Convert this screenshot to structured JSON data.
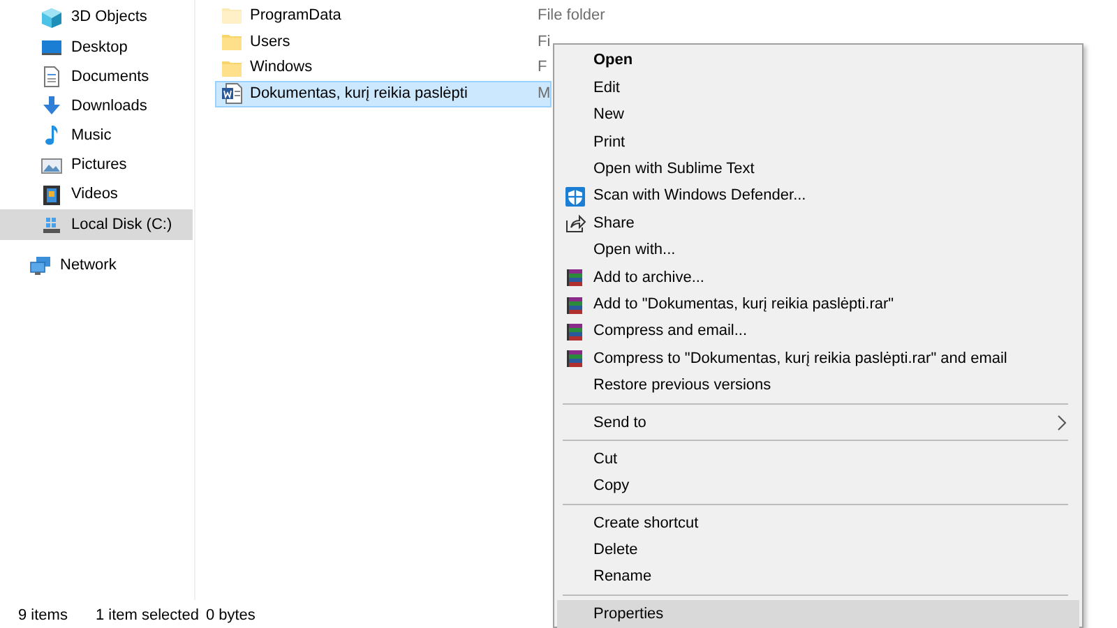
{
  "sidebar": {
    "this_pc_items": [
      {
        "label": "3D Objects",
        "kind": "cube",
        "selected": false
      },
      {
        "label": "Desktop",
        "kind": "desktop",
        "selected": false
      },
      {
        "label": "Documents",
        "kind": "document",
        "selected": false
      },
      {
        "label": "Downloads",
        "kind": "download",
        "selected": false
      },
      {
        "label": "Music",
        "kind": "music",
        "selected": false
      },
      {
        "label": "Pictures",
        "kind": "pictures",
        "selected": false
      },
      {
        "label": "Videos",
        "kind": "videos",
        "selected": false
      },
      {
        "label": "Local Disk (C:)",
        "kind": "disk",
        "selected": true
      }
    ],
    "network": {
      "label": "Network",
      "selected": false
    }
  },
  "files": [
    {
      "name": "ProgramData",
      "type": "File folder",
      "kind": "folder-faded",
      "selected": false
    },
    {
      "name": "Users",
      "type": "Fi",
      "kind": "folder",
      "selected": false
    },
    {
      "name": "Windows",
      "type": "F",
      "kind": "folder",
      "selected": false
    },
    {
      "name": "Dokumentas, kurį reikia paslėpti",
      "type": "M",
      "kind": "word",
      "selected": true
    }
  ],
  "context_menu": [
    {
      "kind": "plain",
      "label": "Open",
      "default": true,
      "selected": false
    },
    {
      "kind": "plain",
      "label": "Edit",
      "default": false,
      "selected": false
    },
    {
      "kind": "plain",
      "label": "New",
      "default": false,
      "selected": false
    },
    {
      "kind": "plain",
      "label": "Print",
      "default": false,
      "selected": false
    },
    {
      "kind": "plain",
      "label": "Open with Sublime Text",
      "default": false,
      "selected": false
    },
    {
      "kind": "defender",
      "label": "Scan with Windows Defender...",
      "default": false,
      "selected": false
    },
    {
      "kind": "share",
      "label": "Share",
      "default": false,
      "selected": false
    },
    {
      "kind": "plain",
      "label": "Open with...",
      "default": false,
      "selected": false
    },
    {
      "kind": "archive",
      "label": "Add to archive...",
      "default": false,
      "selected": false
    },
    {
      "kind": "archive",
      "label": "Add to \"Dokumentas, kurį reikia paslėpti.rar\"",
      "default": false,
      "selected": false
    },
    {
      "kind": "archive",
      "label": "Compress and email...",
      "default": false,
      "selected": false
    },
    {
      "kind": "archive",
      "label": "Compress to \"Dokumentas, kurį reikia paslėpti.rar\" and email",
      "default": false,
      "selected": false
    },
    {
      "kind": "plain",
      "label": "Restore previous versions",
      "default": false,
      "selected": false
    },
    {
      "kind": "separator"
    },
    {
      "kind": "submenu",
      "label": "Send to",
      "default": false,
      "selected": false
    },
    {
      "kind": "separator"
    },
    {
      "kind": "plain",
      "label": "Cut",
      "default": false,
      "selected": false
    },
    {
      "kind": "plain",
      "label": "Copy",
      "default": false,
      "selected": false
    },
    {
      "kind": "separator"
    },
    {
      "kind": "plain",
      "label": "Create shortcut",
      "default": false,
      "selected": false
    },
    {
      "kind": "plain",
      "label": "Delete",
      "default": false,
      "selected": false
    },
    {
      "kind": "plain",
      "label": "Rename",
      "default": false,
      "selected": false
    },
    {
      "kind": "separator"
    },
    {
      "kind": "plain",
      "label": "Properties",
      "default": false,
      "selected": true
    }
  ],
  "status_bar": {
    "item_count": "9 items",
    "selection": "1 item selected",
    "size": "0 bytes"
  }
}
